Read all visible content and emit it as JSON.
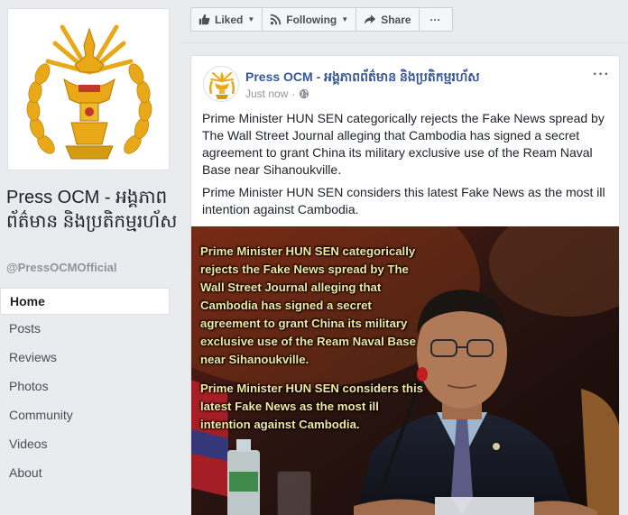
{
  "page": {
    "name": "Press OCM - អង្គភាពព័ត៌មាន និងប្រតិកម្មរហ័ស",
    "handle": "@PressOCMOfficial"
  },
  "nav": {
    "items": [
      {
        "label": "Home",
        "active": true
      },
      {
        "label": "Posts"
      },
      {
        "label": "Reviews"
      },
      {
        "label": "Photos"
      },
      {
        "label": "Community"
      },
      {
        "label": "Videos"
      },
      {
        "label": "About"
      }
    ]
  },
  "actions": {
    "liked": "Liked",
    "following": "Following",
    "share": "Share",
    "more": "···"
  },
  "post": {
    "author": "Press OCM - អង្គភាពព័ត៌មាន និងប្រតិកម្មរហ័ស",
    "time": "Just now",
    "more": "···",
    "paragraphs": [
      "Prime Minister HUN SEN categorically rejects the Fake News spread by The Wall Street Journal alleging that Cambodia has signed a secret agreement to grant China its military exclusive use of the Ream Naval Base near Sihanoukville.",
      "Prime Minister HUN SEN considers this latest Fake News as the most ill intention against Cambodia."
    ],
    "image_text": [
      "Prime Minister HUN SEN categorically rejects the Fake News spread by The Wall Street Journal alleging that Cambodia has signed a secret agreement to grant China its military exclusive use of the Ream Naval Base near Sihanoukville.",
      "Prime Minister HUN SEN considers this latest Fake News as the most ill intention against Cambodia."
    ]
  },
  "colors": {
    "link": "#365899",
    "background": "#e9ebee",
    "emblem_gold": "#e8a817"
  }
}
